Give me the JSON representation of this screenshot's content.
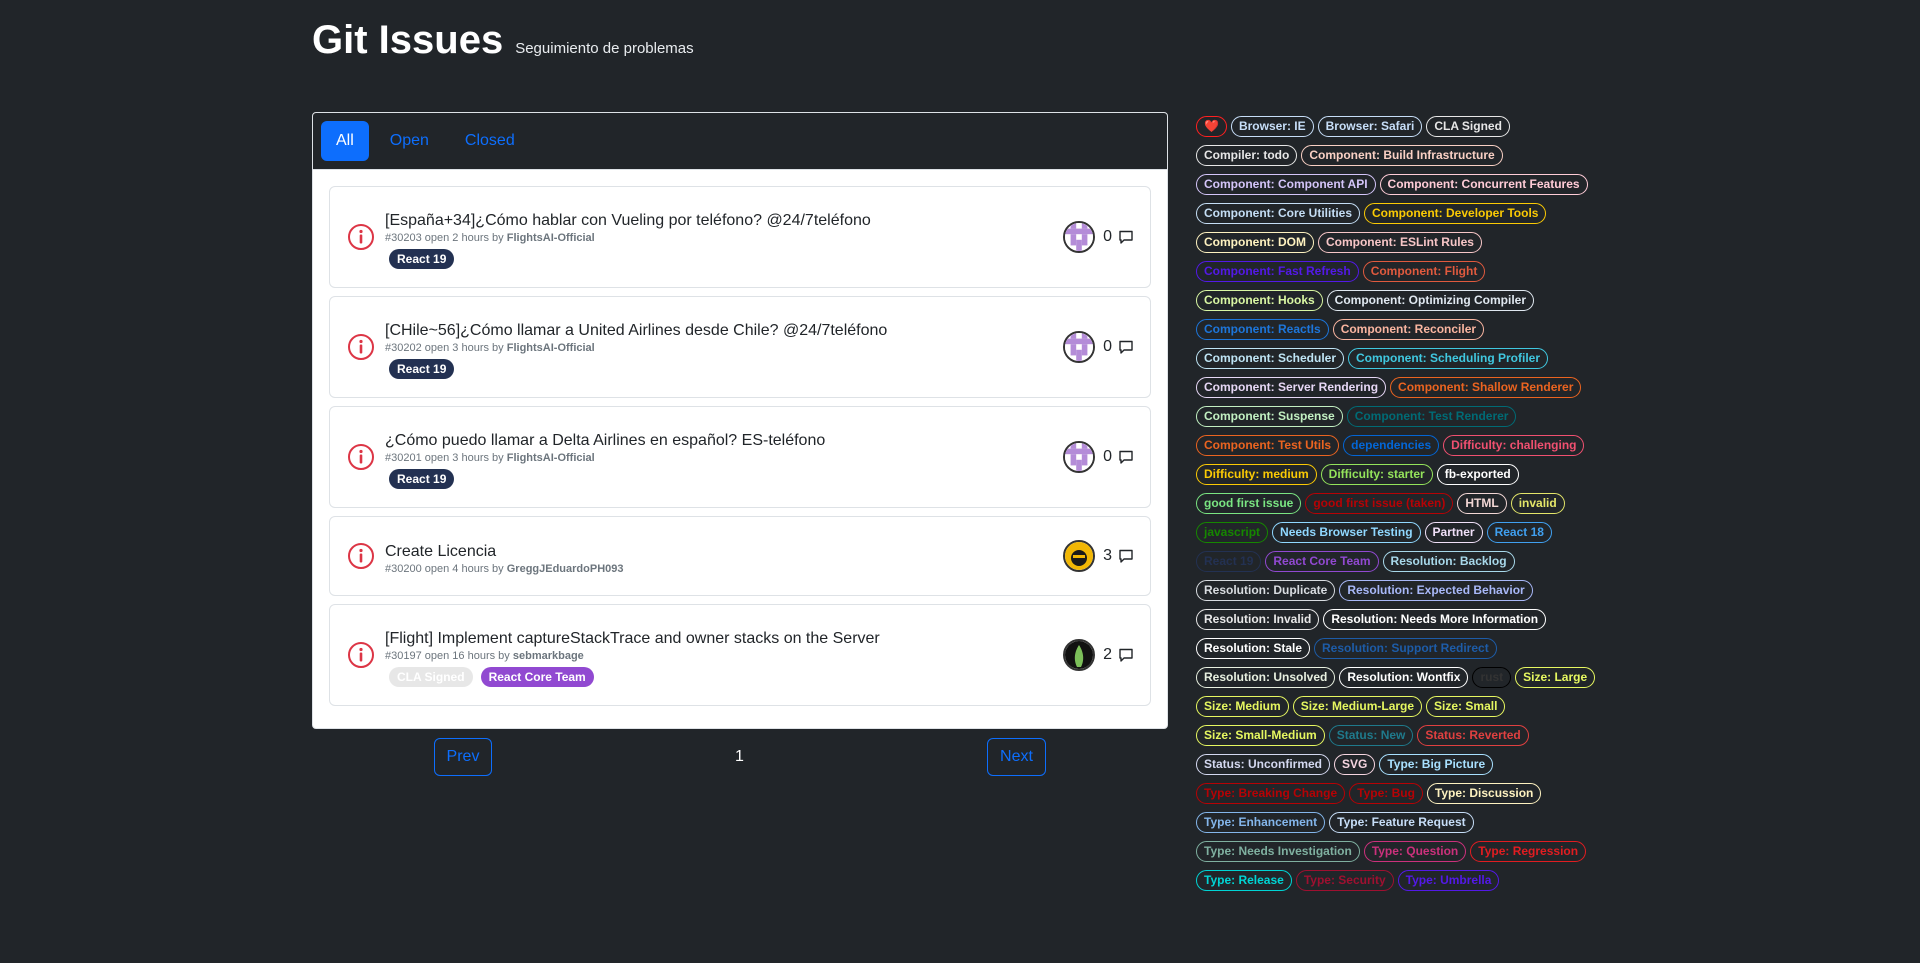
{
  "header": {
    "title": "Git Issues",
    "subtitle": "Seguimiento de problemas"
  },
  "tabs": [
    {
      "label": "All",
      "active": true
    },
    {
      "label": "Open",
      "active": false
    },
    {
      "label": "Closed",
      "active": false
    }
  ],
  "issues": [
    {
      "title": "[España+34]¿Cómo hablar con Vueling por teléfono? @24/7teléfono",
      "number": "#30203",
      "age": "open 2 hours by",
      "author": "FlightsAI-Official",
      "tags": [
        {
          "name": "React 19",
          "bg": "#233152"
        }
      ],
      "comments": "0",
      "avatar": "avatar-purple"
    },
    {
      "title": "[CHile~56]¿Cómo llamar a United Airlines desde Chile? @24/7teléfono",
      "number": "#30202",
      "age": "open 3 hours by",
      "author": "FlightsAI-Official",
      "tags": [
        {
          "name": "React 19",
          "bg": "#233152"
        }
      ],
      "comments": "0",
      "avatar": "avatar-purple"
    },
    {
      "title": "¿Cómo puedo llamar a Delta Airlines en español? ES-teléfono",
      "number": "#30201",
      "age": "open 3 hours by",
      "author": "FlightsAI-Official",
      "tags": [
        {
          "name": "React 19",
          "bg": "#233152"
        }
      ],
      "comments": "0",
      "avatar": "avatar-purple"
    },
    {
      "title": "Create Licencia",
      "number": "#30200",
      "age": "open 4 hours by",
      "author": "GreggJEduardoPH093",
      "tags": [],
      "comments": "3",
      "avatar": "avatar-yellow"
    },
    {
      "title": "[Flight] Implement captureStackTrace and owner stacks on the Server",
      "number": "#30197",
      "age": "open 16 hours by",
      "author": "sebmarkbage",
      "tags": [
        {
          "name": "CLA Signed",
          "bg": "#e7e7e7"
        },
        {
          "name": "React Core Team",
          "bg": "#9149d1"
        }
      ],
      "comments": "2",
      "avatar": "avatar-green"
    }
  ],
  "pager": {
    "prev": "Prev",
    "page": "1",
    "next": "Next"
  },
  "labels": [
    {
      "name": "❤️",
      "color": "#ff2020"
    },
    {
      "name": "Browser: IE",
      "color": "#c7def8"
    },
    {
      "name": "Browser: Safari",
      "color": "#c7def8"
    },
    {
      "name": "CLA Signed",
      "color": "#e7e7e7"
    },
    {
      "name": "Compiler: todo",
      "color": "#e7e7e7"
    },
    {
      "name": "Component: Build Infrastructure",
      "color": "#f9d0c4"
    },
    {
      "name": "Component: Component API",
      "color": "#d4c5f9"
    },
    {
      "name": "Component: Concurrent Features",
      "color": "#ffccd7"
    },
    {
      "name": "Component: Core Utilities",
      "color": "#c5def5"
    },
    {
      "name": "Component: Developer Tools",
      "color": "#fbca04"
    },
    {
      "name": "Component: DOM",
      "color": "#fef2c0"
    },
    {
      "name": "Component: ESLint Rules",
      "color": "#f7c6c7"
    },
    {
      "name": "Component: Fast Refresh",
      "color": "#5319e7"
    },
    {
      "name": "Component: Flight",
      "color": "#e05a3e"
    },
    {
      "name": "Component: Hooks",
      "color": "#d9f7a3"
    },
    {
      "name": "Component: Optimizing Compiler",
      "color": "#e0e8f0"
    },
    {
      "name": "Component: ReactIs",
      "color": "#1d76db"
    },
    {
      "name": "Component: Reconciler",
      "color": "#f9b5a0"
    },
    {
      "name": "Component: Scheduler",
      "color": "#bfe5f5"
    },
    {
      "name": "Component: Scheduling Profiler",
      "color": "#40c8e0"
    },
    {
      "name": "Component: Server Rendering",
      "color": "#e6d7f5"
    },
    {
      "name": "Component: Shallow Renderer",
      "color": "#eb6420"
    },
    {
      "name": "Component: Suspense",
      "color": "#c2f0c2"
    },
    {
      "name": "Component: Test Renderer",
      "color": "#006b75"
    },
    {
      "name": "Component: Test Utils",
      "color": "#eb6420"
    },
    {
      "name": "dependencies",
      "color": "#0366d6"
    },
    {
      "name": "Difficulty: challenging",
      "color": "#f05070"
    },
    {
      "name": "Difficulty: medium",
      "color": "#fbca04"
    },
    {
      "name": "Difficulty: starter",
      "color": "#94e35b"
    },
    {
      "name": "fb-exported",
      "color": "#ffffff"
    },
    {
      "name": "good first issue",
      "color": "#7ae582"
    },
    {
      "name": "good first issue (taken)",
      "color": "#b60205"
    },
    {
      "name": "HTML",
      "color": "#f2d7d5"
    },
    {
      "name": "invalid",
      "color": "#e4e669"
    },
    {
      "name": "javascript",
      "color": "#168700"
    },
    {
      "name": "Needs Browser Testing",
      "color": "#90d8ff"
    },
    {
      "name": "Partner",
      "color": "#f0e0f8"
    },
    {
      "name": "React 18",
      "color": "#40a0f0"
    },
    {
      "name": "React 19",
      "color": "#233152"
    },
    {
      "name": "React Core Team",
      "color": "#9149d1"
    },
    {
      "name": "Resolution: Backlog",
      "color": "#a8d8ea"
    },
    {
      "name": "Resolution: Duplicate",
      "color": "#d8dce0"
    },
    {
      "name": "Resolution: Expected Behavior",
      "color": "#a8b8f8"
    },
    {
      "name": "Resolution: Invalid",
      "color": "#e8e8e8"
    },
    {
      "name": "Resolution: Needs More Information",
      "color": "#ffffff"
    },
    {
      "name": "Resolution: Stale",
      "color": "#ffffff"
    },
    {
      "name": "Resolution: Support Redirect",
      "color": "#1d5ca8"
    },
    {
      "name": "Resolution: Unsolved",
      "color": "#e8f0e0"
    },
    {
      "name": "Resolution: Wontfix",
      "color": "#ffffff"
    },
    {
      "name": "rust",
      "color": "#000000"
    },
    {
      "name": "Size: Large",
      "color": "#e6f760"
    },
    {
      "name": "Size: Medium",
      "color": "#e6f760"
    },
    {
      "name": "Size: Medium-Large",
      "color": "#e6f760"
    },
    {
      "name": "Size: Small",
      "color": "#e6f760"
    },
    {
      "name": "Size: Small-Medium",
      "color": "#e6f760"
    },
    {
      "name": "Status: New",
      "color": "#1f7a8c"
    },
    {
      "name": "Status: Reverted",
      "color": "#e04040"
    },
    {
      "name": "Status: Unconfirmed",
      "color": "#d4d8f0"
    },
    {
      "name": "SVG",
      "color": "#f5d5e0"
    },
    {
      "name": "Type: Big Picture",
      "color": "#a8e0ff"
    },
    {
      "name": "Type: Breaking Change",
      "color": "#b60205"
    },
    {
      "name": "Type: Bug",
      "color": "#b60205"
    },
    {
      "name": "Type: Discussion",
      "color": "#fef2c0"
    },
    {
      "name": "Type: Enhancement",
      "color": "#84b6eb"
    },
    {
      "name": "Type: Feature Request",
      "color": "#c7def8"
    },
    {
      "name": "Type: Needs Investigation",
      "color": "#7fb0a0"
    },
    {
      "name": "Type: Question",
      "color": "#cc317c"
    },
    {
      "name": "Type: Regression",
      "color": "#e11d21"
    },
    {
      "name": "Type: Release",
      "color": "#00d4d4"
    },
    {
      "name": "Type: Security",
      "color": "#9e1030"
    },
    {
      "name": "Type: Umbrella",
      "color": "#5319e7"
    }
  ]
}
